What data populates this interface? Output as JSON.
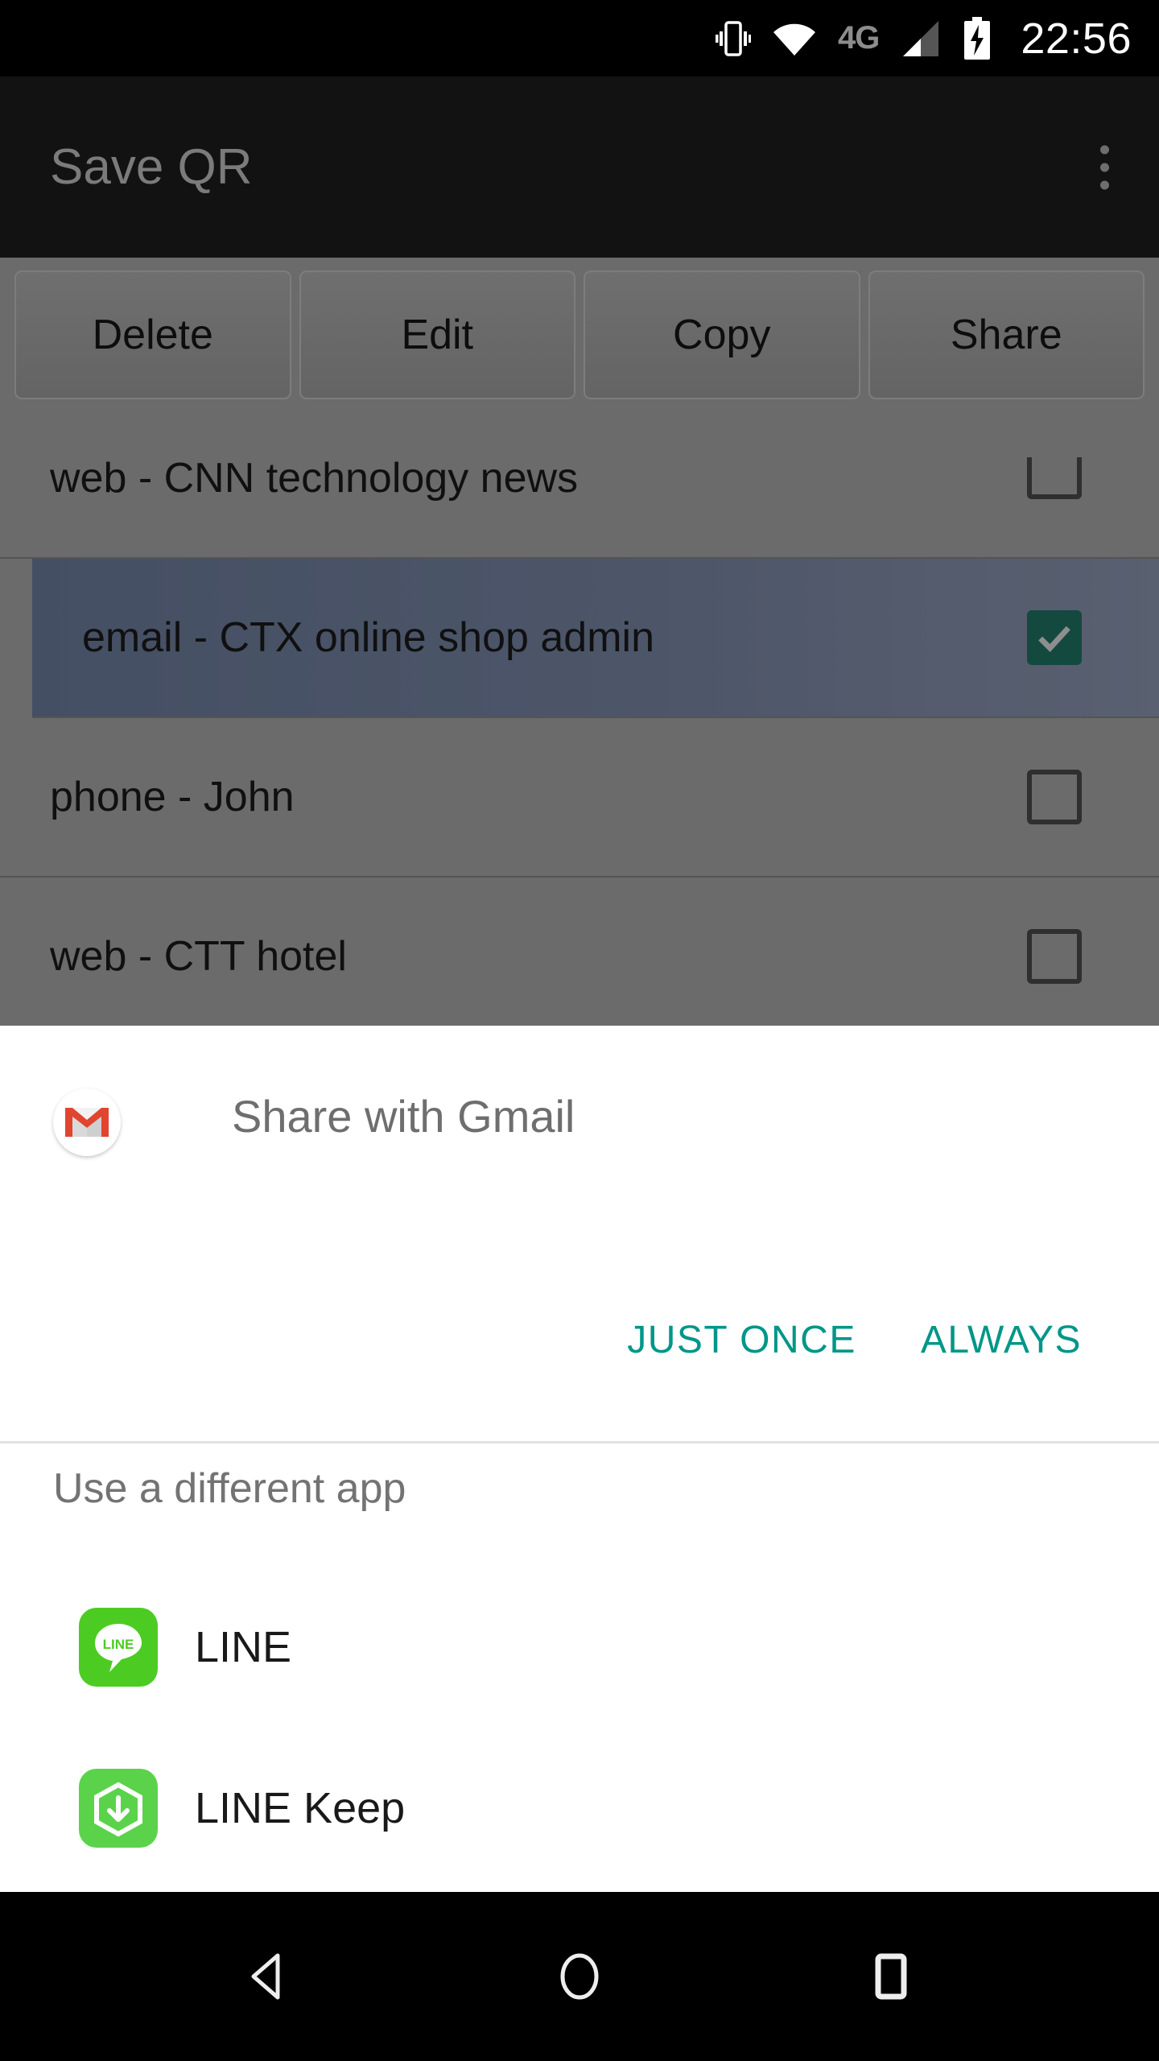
{
  "statusbar": {
    "icons": [
      "vibrate-icon",
      "wifi-icon",
      "signal-icon",
      "battery-charging-icon"
    ],
    "network_label": "4G",
    "time": "22:56"
  },
  "app": {
    "title": "Save QR",
    "overflow_menu": "more-options",
    "buttons": [
      {
        "label": "Delete",
        "name": "delete-button"
      },
      {
        "label": "Edit",
        "name": "edit-button"
      },
      {
        "label": "Copy",
        "name": "copy-button"
      },
      {
        "label": "Share",
        "name": "share-button"
      }
    ],
    "list": [
      {
        "label": "web - CNN technology news",
        "checked": false,
        "selected": false
      },
      {
        "label": "email - CTX online shop admin",
        "checked": true,
        "selected": true
      },
      {
        "label": "phone - John",
        "checked": false,
        "selected": false
      },
      {
        "label": "web - CTT hotel",
        "checked": false,
        "selected": false
      }
    ]
  },
  "dialog": {
    "primary": {
      "app_icon": "gmail-icon",
      "label": "Share with Gmail"
    },
    "actions": {
      "just_once": "JUST ONCE",
      "always": "ALWAYS"
    },
    "section_title": "Use a different app",
    "apps": [
      {
        "name": "LINE",
        "icon": "line-icon"
      },
      {
        "name": "LINE Keep",
        "icon": "line-keep-icon"
      }
    ]
  },
  "navbar": {
    "back": "back-button",
    "home": "home-button",
    "recents": "recents-button"
  },
  "colors": {
    "accent_teal": "#009688",
    "checkbox_checked": "#14493f",
    "selected_row": "#4d5669",
    "scrim": "#6b6b6b",
    "line_green": "#4ccc22",
    "gmail_red": "#e0452f"
  }
}
